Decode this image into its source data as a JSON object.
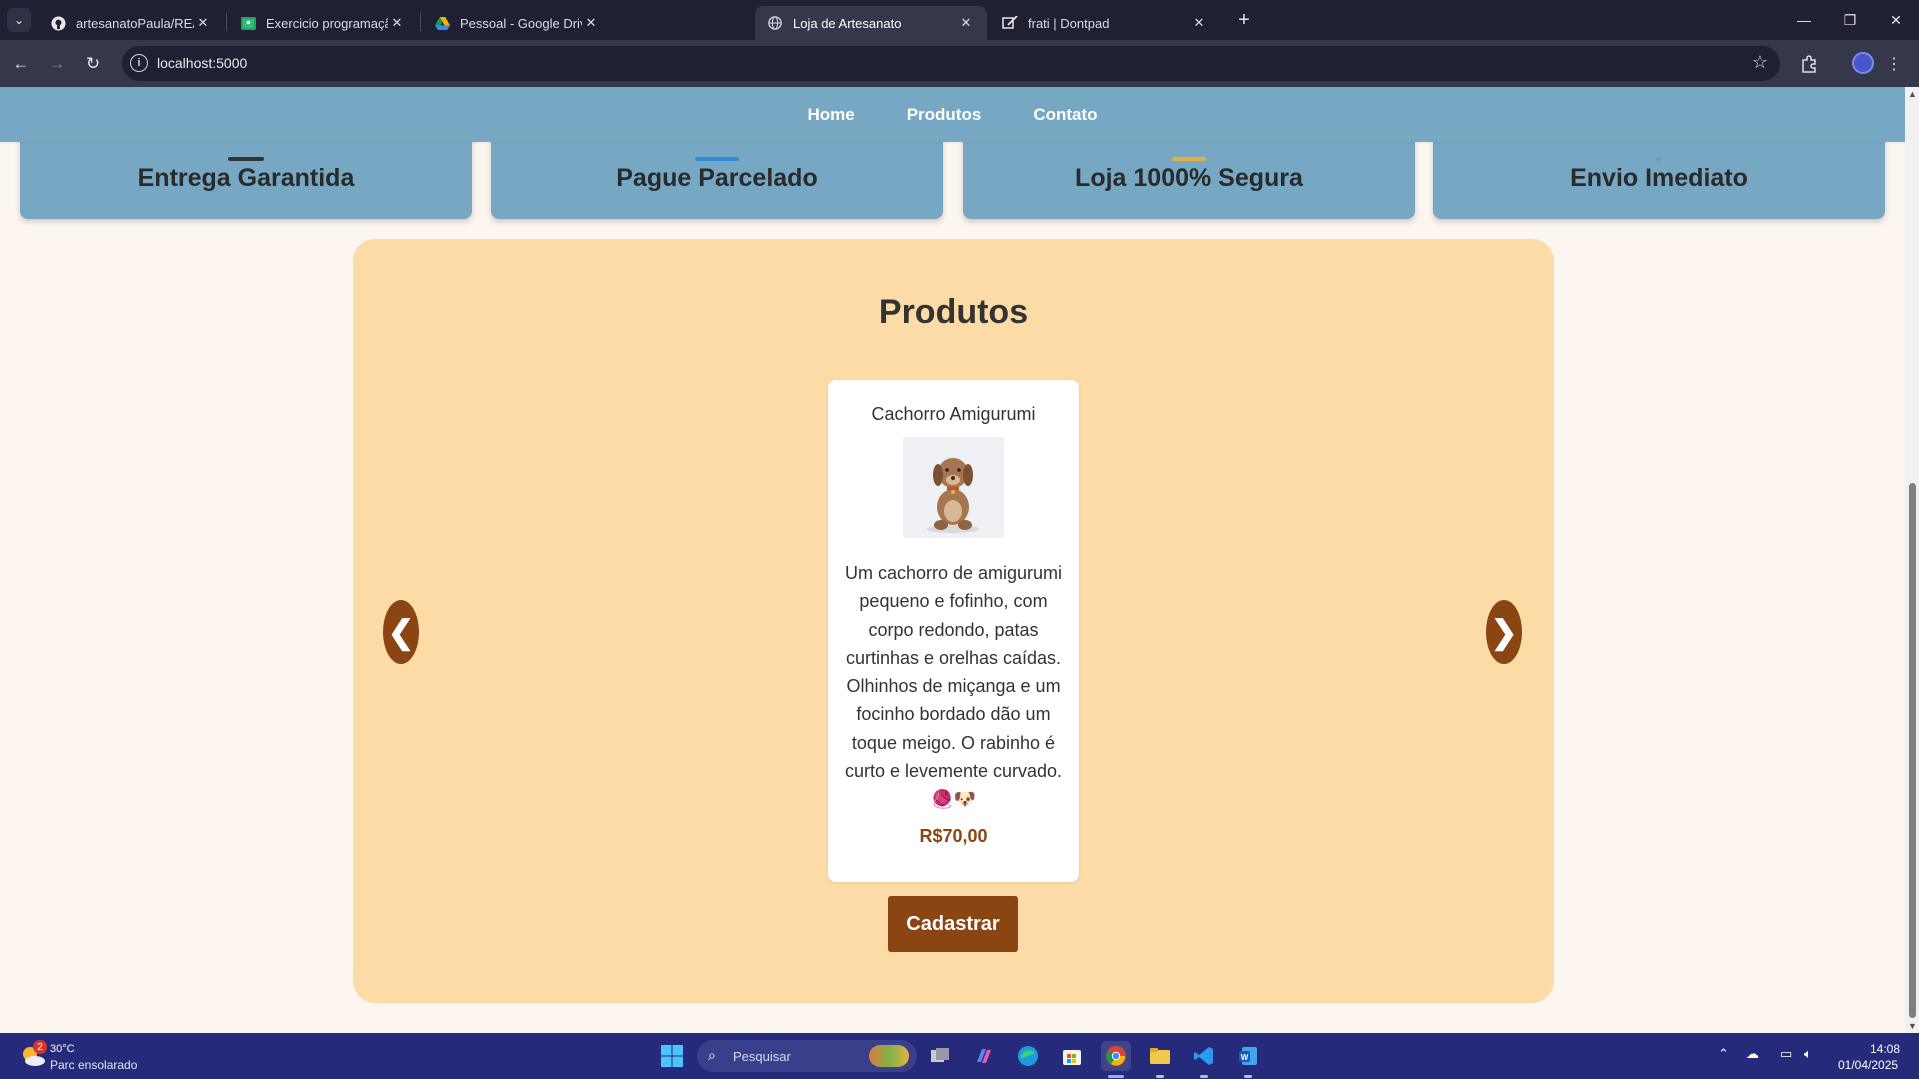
{
  "browser": {
    "tabs": [
      {
        "title": "artesanatoPaula/README.md at",
        "favicon": "github-icon",
        "active": false
      },
      {
        "title": "Exercicio programação Back End",
        "favicon": "classroom-icon",
        "active": false
      },
      {
        "title": "Pessoal - Google Drive",
        "favicon": "drive-icon",
        "active": false
      },
      {
        "title": "Loja de Artesanato",
        "favicon": "globe-icon",
        "active": true
      },
      {
        "title": "frati | Dontpad",
        "favicon": "dontpad-icon",
        "active": false
      }
    ],
    "url": "localhost:5000"
  },
  "site": {
    "nav": [
      {
        "label": "Home"
      },
      {
        "label": "Produtos"
      },
      {
        "label": "Contato"
      }
    ],
    "features": [
      {
        "label": "Entrega Garantida",
        "icon": "truck-icon",
        "accent": "#333333"
      },
      {
        "label": "Pague Parcelado",
        "icon": "card-icon",
        "accent": "#2a8fd6"
      },
      {
        "label": "Loja 1000% Segura",
        "icon": "lock-icon",
        "accent": "#e9b040"
      },
      {
        "label": "Envio Imediato",
        "icon": "box-icon",
        "accent": "#76a8c4"
      }
    ],
    "products": {
      "heading": "Produtos",
      "prev_label": "❮",
      "next_label": "❯",
      "item": {
        "name": "Cachorro Amigurumi",
        "description": "Um cachorro de amigurumi pequeno e fofinho, com corpo redondo, patas curtinhas e orelhas caídas. Olhinhos de miçanga e um focinho bordado dão um toque meigo. O rabinho é curto e levemente curvado. 🧶🐶",
        "price": "R$70,00"
      },
      "register_label": "Cadastrar"
    }
  },
  "colors": {
    "nav_bg": "#76a8c4",
    "section_bg": "#fcdba7",
    "accent_brown": "#8b4513",
    "page_bg": "#fdf6f0"
  },
  "taskbar": {
    "weather_badge": "2",
    "weather_temp": "30°C",
    "weather_desc": "Parc ensolarado",
    "search_placeholder": "Pesquisar",
    "time": "14:08",
    "date": "01/04/2025"
  }
}
